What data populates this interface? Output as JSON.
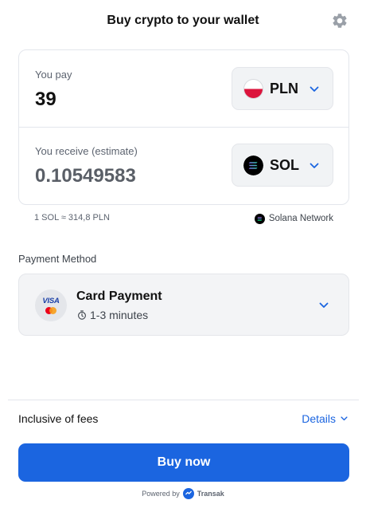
{
  "header": {
    "title": "Buy crypto to your wallet",
    "settings_icon": "gear-icon"
  },
  "pay": {
    "label": "You pay",
    "amount": "39",
    "currency": "PLN",
    "currency_icon": "poland-flag-icon"
  },
  "receive": {
    "label": "You receive (estimate)",
    "amount": "0.10549583",
    "currency": "SOL",
    "currency_icon": "solana-logo-icon"
  },
  "rate": {
    "text": "1 SOL ≈ 314,8 PLN",
    "network_label": "Solana Network"
  },
  "payment_method": {
    "section_label": "Payment Method",
    "name": "Card Payment",
    "duration": "1-3 minutes",
    "card_logo_text": "VISA",
    "timer_icon": "stopwatch-icon"
  },
  "fees": {
    "label": "Inclusive of fees",
    "details_label": "Details"
  },
  "buy_button": {
    "label": "Buy now"
  },
  "footer": {
    "powered_by": "Powered by",
    "brand": "Transak"
  },
  "colors": {
    "accent": "#1b65e0",
    "card_bg": "#f3f4f6",
    "border": "#e3e6ec",
    "text_muted": "#5d6470"
  }
}
